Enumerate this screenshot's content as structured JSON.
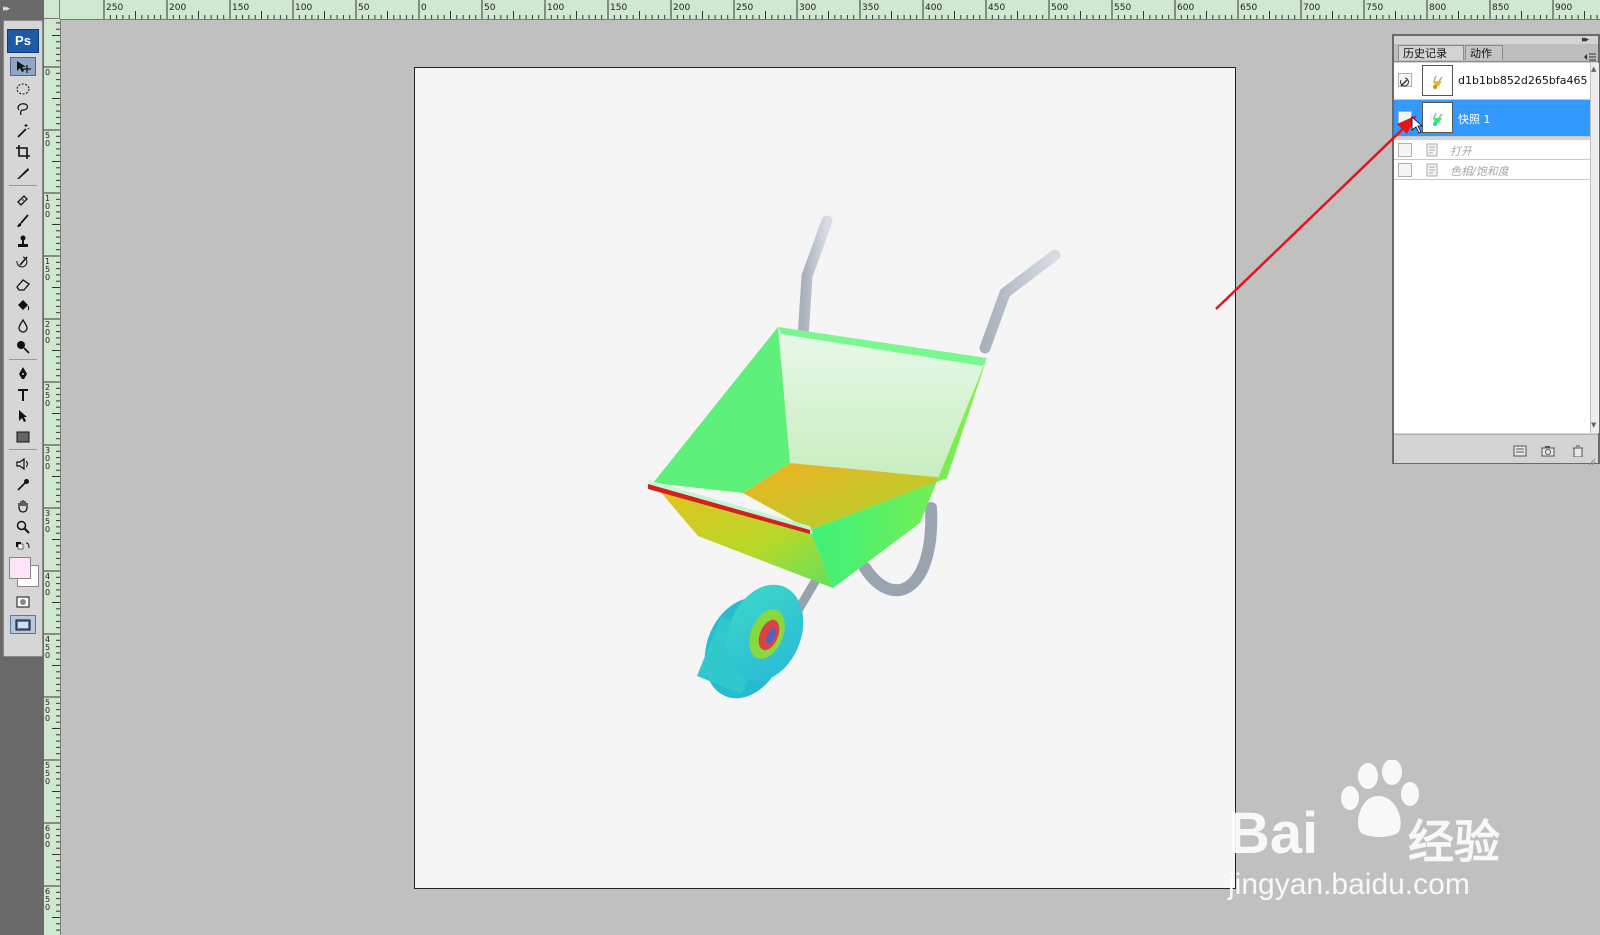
{
  "app": {
    "logo": "Ps"
  },
  "ruler_top": {
    "labels": [
      "250",
      "200",
      "150",
      "100",
      "50",
      "0",
      "50",
      "100",
      "150",
      "200",
      "250",
      "300",
      "350",
      "400",
      "450",
      "500",
      "550",
      "600",
      "650",
      "700",
      "750",
      "800",
      "850",
      "900"
    ]
  },
  "ruler_left": {
    "labels": [
      "0",
      "50",
      "100",
      "150",
      "200",
      "250",
      "300",
      "350",
      "400",
      "450",
      "500",
      "550",
      "600",
      "650"
    ]
  },
  "history_panel": {
    "tabs": [
      {
        "label": "历史记录",
        "close": "×"
      },
      {
        "label": "动作"
      }
    ],
    "snapshots": [
      {
        "label": "d1b1bb852d265bfa465..."
      },
      {
        "label": "快照 1"
      }
    ],
    "steps": [
      {
        "label": "打开"
      },
      {
        "label": "色相/饱和度"
      }
    ]
  },
  "watermark": {
    "brand": "Bai",
    "brand_suffix": "经验",
    "url": "jingyan.baidu.com"
  },
  "colors": {
    "selection": "#3399ff",
    "annotation_arrow": "#e3141b",
    "ps_logo": "#1f5aa6"
  }
}
